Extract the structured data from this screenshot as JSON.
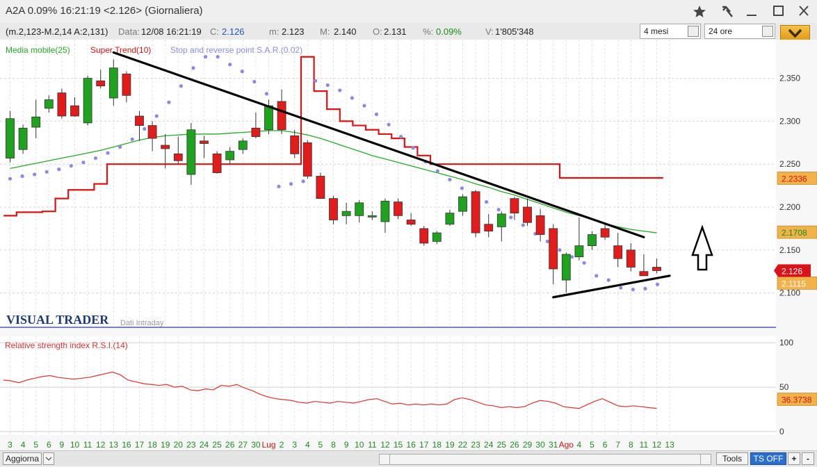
{
  "window": {
    "title": "A2A 0.09% 16:21:19 <2.126> (Giornaliera)"
  },
  "info": {
    "params": "(m.2,123-M.2,14 A:2,131)",
    "data_label": "Data:",
    "data_value": "12/08 16:21:19",
    "c_label": "C:",
    "c_value": "2.126",
    "m_label": "m:",
    "m_value": "2.123",
    "M_label": "M:",
    "M_value": "2.140",
    "o_label": "O:",
    "o_value": "2.131",
    "pct_label": "%:",
    "pct_value": "0.09%",
    "v_label": "V:",
    "v_value": "1'805'348"
  },
  "controls": {
    "period": "4 mesi",
    "interval": "24 ore"
  },
  "legend": {
    "ma": "Media mobile(25)",
    "st": "Super Trend(10)",
    "sar": "Stop and reverse point S.A.R.(0.02)"
  },
  "watermark": {
    "brand": "VISUAL TRADER",
    "sub": "Dati Intraday"
  },
  "rsi_panel": {
    "title": "Relative strength index R.S.I.(14)",
    "ticks": [
      "100",
      "50",
      "0"
    ],
    "last_label": "36.3738"
  },
  "price_labels": {
    "supertrend": "2.2336",
    "ma": "2.1708",
    "last": "2.126",
    "sar": "2.1115"
  },
  "bottombar": {
    "aggiorna": "Aggiorna",
    "tools": "Tools",
    "ts_off": "TS OFF",
    "plus": "+",
    "minus": "-"
  },
  "colors": {
    "up": "#1fa31f",
    "down": "#e21b1b",
    "ma": "#22aa22",
    "supertrend": "#e01010",
    "sar": "#8a8ae6",
    "rsi": "#e03030",
    "trendline": "#000000"
  },
  "chart_data": {
    "type": "candlestick",
    "ylim": [
      2.06,
      2.395
    ],
    "yticks": [
      "2.350",
      "2.300",
      "2.250",
      "2.200",
      "2.150",
      "2.100"
    ],
    "xticks": [
      "3",
      "4",
      "5",
      "6",
      "9",
      "10",
      "11",
      "12",
      "13",
      "16",
      "17",
      "18",
      "19",
      "20",
      "23",
      "24",
      "25",
      "26",
      "27",
      "30",
      "Lug",
      "2",
      "3",
      "4",
      "5",
      "8",
      "9",
      "10",
      "11",
      "12",
      "15",
      "16",
      "17",
      "18",
      "19",
      "22",
      "23",
      "24",
      "25",
      "26",
      "29",
      "30",
      "31",
      "Ago",
      "4",
      "5",
      "6",
      "7",
      "8",
      "11",
      "12",
      "13"
    ],
    "candles": [
      {
        "o": 2.257,
        "h": 2.312,
        "l": 2.252,
        "c": 2.303
      },
      {
        "o": 2.267,
        "h": 2.296,
        "l": 2.262,
        "c": 2.292
      },
      {
        "o": 2.293,
        "h": 2.325,
        "l": 2.28,
        "c": 2.305
      },
      {
        "o": 2.315,
        "h": 2.33,
        "l": 2.31,
        "c": 2.325
      },
      {
        "o": 2.333,
        "h": 2.338,
        "l": 2.303,
        "c": 2.306
      },
      {
        "o": 2.318,
        "h": 2.328,
        "l": 2.305,
        "c": 2.306
      },
      {
        "o": 2.298,
        "h": 2.353,
        "l": 2.295,
        "c": 2.35
      },
      {
        "o": 2.347,
        "h": 2.36,
        "l": 2.338,
        "c": 2.341
      },
      {
        "o": 2.327,
        "h": 2.372,
        "l": 2.318,
        "c": 2.362
      },
      {
        "o": 2.355,
        "h": 2.358,
        "l": 2.322,
        "c": 2.33
      },
      {
        "o": 2.306,
        "h": 2.312,
        "l": 2.277,
        "c": 2.295
      },
      {
        "o": 2.295,
        "h": 2.3,
        "l": 2.265,
        "c": 2.28
      },
      {
        "o": 2.272,
        "h": 2.285,
        "l": 2.245,
        "c": 2.268
      },
      {
        "o": 2.262,
        "h": 2.282,
        "l": 2.25,
        "c": 2.254
      },
      {
        "o": 2.238,
        "h": 2.298,
        "l": 2.226,
        "c": 2.29
      },
      {
        "o": 2.277,
        "h": 2.283,
        "l": 2.257,
        "c": 2.274
      },
      {
        "o": 2.262,
        "h": 2.265,
        "l": 2.239,
        "c": 2.24
      },
      {
        "o": 2.255,
        "h": 2.27,
        "l": 2.25,
        "c": 2.265
      },
      {
        "o": 2.267,
        "h": 2.28,
        "l": 2.262,
        "c": 2.277
      },
      {
        "o": 2.292,
        "h": 2.31,
        "l": 2.28,
        "c": 2.282
      },
      {
        "o": 2.29,
        "h": 2.325,
        "l": 2.285,
        "c": 2.318
      },
      {
        "o": 2.323,
        "h": 2.337,
        "l": 2.285,
        "c": 2.29
      },
      {
        "o": 2.283,
        "h": 2.29,
        "l": 2.257,
        "c": 2.262
      },
      {
        "o": 2.275,
        "h": 2.278,
        "l": 2.233,
        "c": 2.236
      },
      {
        "o": 2.236,
        "h": 2.24,
        "l": 2.21,
        "c": 2.21
      },
      {
        "o": 2.21,
        "h": 2.213,
        "l": 2.18,
        "c": 2.185
      },
      {
        "o": 2.19,
        "h": 2.205,
        "l": 2.18,
        "c": 2.195
      },
      {
        "o": 2.19,
        "h": 2.208,
        "l": 2.182,
        "c": 2.205
      },
      {
        "o": 2.19,
        "h": 2.195,
        "l": 2.185,
        "c": 2.19
      },
      {
        "o": 2.183,
        "h": 2.21,
        "l": 2.17,
        "c": 2.207
      },
      {
        "o": 2.206,
        "h": 2.21,
        "l": 2.186,
        "c": 2.19
      },
      {
        "o": 2.185,
        "h": 2.193,
        "l": 2.178,
        "c": 2.18
      },
      {
        "o": 2.175,
        "h": 2.178,
        "l": 2.155,
        "c": 2.158
      },
      {
        "o": 2.16,
        "h": 2.172,
        "l": 2.157,
        "c": 2.17
      },
      {
        "o": 2.18,
        "h": 2.197,
        "l": 2.178,
        "c": 2.193
      },
      {
        "o": 2.195,
        "h": 2.215,
        "l": 2.19,
        "c": 2.212
      },
      {
        "o": 2.218,
        "h": 2.22,
        "l": 2.165,
        "c": 2.17
      },
      {
        "o": 2.18,
        "h": 2.192,
        "l": 2.165,
        "c": 2.172
      },
      {
        "o": 2.177,
        "h": 2.195,
        "l": 2.16,
        "c": 2.192
      },
      {
        "o": 2.21,
        "h": 2.212,
        "l": 2.185,
        "c": 2.193
      },
      {
        "o": 2.2,
        "h": 2.21,
        "l": 2.178,
        "c": 2.182
      },
      {
        "o": 2.19,
        "h": 2.198,
        "l": 2.16,
        "c": 2.168
      },
      {
        "o": 2.175,
        "h": 2.18,
        "l": 2.11,
        "c": 2.128
      },
      {
        "o": 2.115,
        "h": 2.147,
        "l": 2.1,
        "c": 2.145
      },
      {
        "o": 2.142,
        "h": 2.188,
        "l": 2.138,
        "c": 2.155
      },
      {
        "o": 2.155,
        "h": 2.172,
        "l": 2.15,
        "c": 2.168
      },
      {
        "o": 2.175,
        "h": 2.18,
        "l": 2.162,
        "c": 2.165
      },
      {
        "o": 2.155,
        "h": 2.17,
        "l": 2.13,
        "c": 2.14
      },
      {
        "o": 2.15,
        "h": 2.158,
        "l": 2.125,
        "c": 2.13
      },
      {
        "o": 2.125,
        "h": 2.145,
        "l": 2.12,
        "c": 2.12
      },
      {
        "o": 2.13,
        "h": 2.14,
        "l": 2.123,
        "c": 2.126
      }
    ],
    "moving_average": [
      2.245,
      2.248,
      2.251,
      2.254,
      2.257,
      2.26,
      2.263,
      2.266,
      2.27,
      2.274,
      2.278,
      2.281,
      2.283,
      2.284,
      2.285,
      2.285,
      2.285,
      2.286,
      2.287,
      2.288,
      2.289,
      2.289,
      2.287,
      2.284,
      2.28,
      2.275,
      2.27,
      2.265,
      2.26,
      2.256,
      2.252,
      2.248,
      2.244,
      2.24,
      2.236,
      2.232,
      2.227,
      2.223,
      2.218,
      2.214,
      2.209,
      2.204,
      2.199,
      2.194,
      2.19,
      2.186,
      2.181,
      2.177,
      2.174,
      2.172,
      2.17
    ],
    "supertrend": [
      2.19,
      2.194,
      2.194,
      2.195,
      2.21,
      2.22,
      2.22,
      2.227,
      2.25,
      2.25,
      2.25,
      2.25,
      2.25,
      2.25,
      2.25,
      2.25,
      2.25,
      2.25,
      2.25,
      2.25,
      2.25,
      2.25,
      2.25,
      2.375,
      2.335,
      2.314,
      2.3,
      2.295,
      2.29,
      2.285,
      2.28,
      2.27,
      2.26,
      2.25,
      2.25,
      2.25,
      2.25,
      2.25,
      2.25,
      2.25,
      2.25,
      2.25,
      2.25,
      2.234,
      2.234,
      2.234,
      2.234,
      2.234,
      2.234,
      2.234,
      2.234
    ],
    "sar": [
      2.233,
      2.236,
      2.238,
      2.241,
      2.244,
      2.248,
      2.252,
      2.257,
      2.263,
      2.27,
      2.279,
      2.291,
      2.306,
      2.322,
      2.341,
      2.362,
      2.375,
      2.375,
      2.366,
      2.358,
      2.346,
      2.332,
      2.224,
      2.227,
      2.23,
      2.347,
      2.342,
      2.336,
      2.327,
      2.318,
      2.308,
      2.296,
      2.282,
      2.269,
      2.253,
      2.242,
      2.232,
      2.222,
      2.214,
      2.206,
      2.197,
      2.188,
      2.179,
      2.169,
      2.16,
      2.15,
      2.142,
      2.135,
      2.12,
      2.115,
      2.106,
      2.104,
      2.105,
      2.11
    ],
    "trendlines": [
      {
        "from": [
          8,
          2.38
        ],
        "to": [
          49,
          2.165
        ]
      },
      {
        "from": [
          42,
          2.095
        ],
        "to": [
          51,
          2.12
        ]
      }
    ],
    "rsi": [
      58,
      57,
      55,
      58,
      60,
      62,
      63,
      61,
      60,
      59,
      60,
      61,
      63,
      65,
      67,
      64,
      58,
      56,
      54,
      53,
      52,
      53,
      50,
      51,
      47,
      46,
      48,
      47,
      52,
      51,
      53,
      49,
      46,
      42,
      39,
      37,
      36,
      35,
      33,
      32,
      34,
      33,
      32,
      34,
      33,
      32,
      34,
      36,
      37,
      34,
      31,
      32,
      30,
      31,
      30,
      31,
      30,
      31,
      36,
      38,
      36,
      33,
      30,
      29,
      27,
      28,
      27,
      28,
      32,
      35,
      34,
      32,
      28,
      27,
      26,
      30,
      34,
      37,
      33,
      29,
      28,
      29,
      28,
      27,
      26
    ]
  }
}
